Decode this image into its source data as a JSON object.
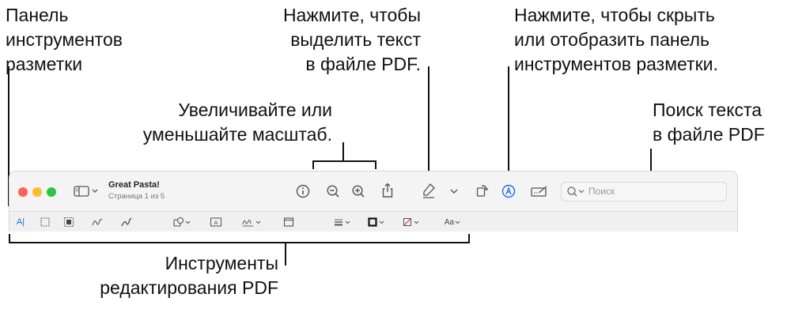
{
  "callouts": {
    "markup_panel": [
      "Панель",
      "инструментов",
      "разметки"
    ],
    "highlight": [
      "Нажмите, чтобы",
      "выделить текст",
      "в файле PDF."
    ],
    "toggle_markup": [
      "Нажмите, чтобы скрыть",
      "или отобразить панель",
      "инструментов разметки."
    ],
    "zoom": [
      "Увеличивайте или",
      "уменьшайте масштаб."
    ],
    "search": [
      "Поиск текста",
      "в файле PDF"
    ],
    "edit_tools": [
      "Инструменты",
      "редактирования PDF"
    ]
  },
  "window": {
    "title": "Great Pasta!",
    "subtitle": "Страница 1 из 5",
    "search_placeholder": "Поиск",
    "accent_color": "#1a6fe0",
    "traffic_lights": [
      "#fe5f57",
      "#febc2e",
      "#28c840"
    ]
  },
  "markup_toolbar": {
    "text_select_label": "A|",
    "text_box_label": "A",
    "font_label": "Aa"
  }
}
